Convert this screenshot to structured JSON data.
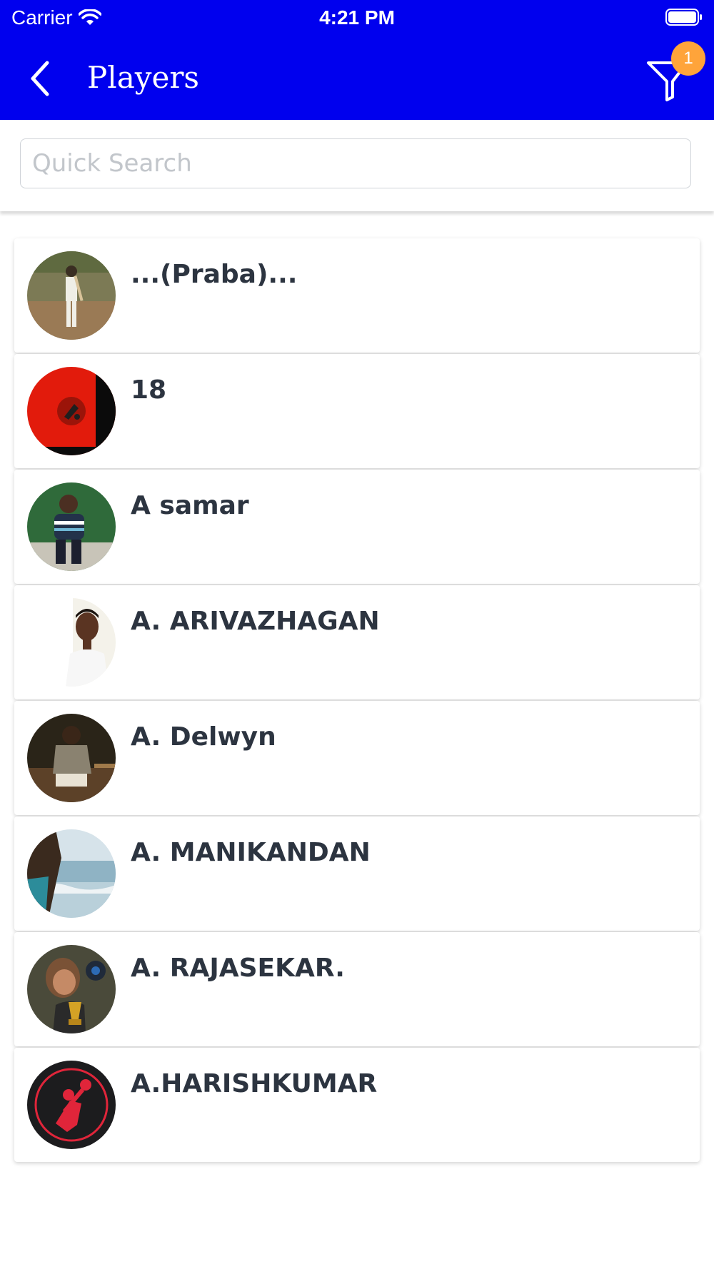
{
  "status_bar": {
    "carrier": "Carrier",
    "time": "4:21 PM"
  },
  "header": {
    "title": "Players",
    "filter_badge": "1"
  },
  "search": {
    "placeholder": "Quick Search",
    "value": ""
  },
  "players": [
    {
      "name": "...(Praba)...",
      "avatar": "photo-cricketer-field"
    },
    {
      "name": "18",
      "avatar": "logo-red-black"
    },
    {
      "name": "A samar",
      "avatar": "photo-person-outdoors"
    },
    {
      "name": "A. ARIVAZHAGAN",
      "avatar": "photo-person-portrait"
    },
    {
      "name": "A. Delwyn",
      "avatar": "photo-person-seated"
    },
    {
      "name": "A. MANIKANDAN",
      "avatar": "photo-beach"
    },
    {
      "name": "A. RAJASEKAR.",
      "avatar": "photo-child-trophy"
    },
    {
      "name": "A.HARISHKUMAR",
      "avatar": "logo-cricket-red"
    }
  ],
  "colors": {
    "header_bg": "#0000ee",
    "badge": "#ffa43a"
  }
}
